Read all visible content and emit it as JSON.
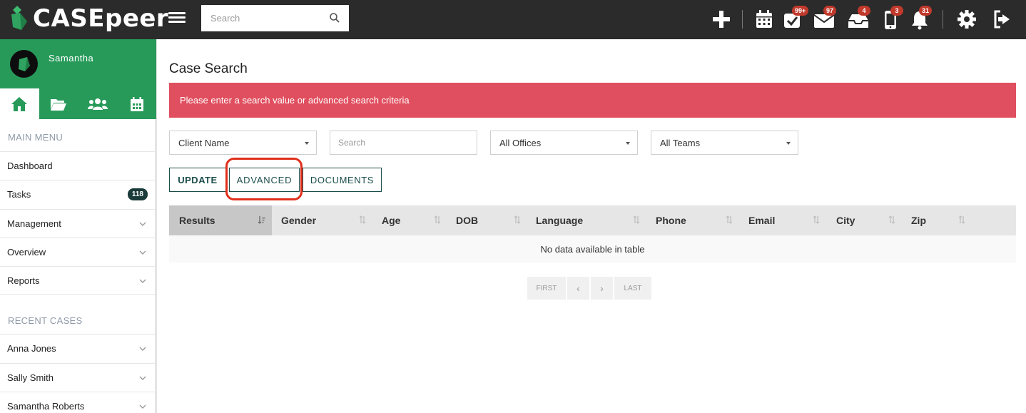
{
  "app": {
    "brand": "CASEpeer",
    "search_placeholder": "Search"
  },
  "toolbar": {
    "icons": [
      "plus-icon",
      "calendar-icon",
      "tasks-check-icon",
      "mail-icon",
      "inbox-icon",
      "mobile-icon",
      "bell-icon",
      "gear-icon",
      "logout-icon"
    ],
    "badges": {
      "tasks": "99+",
      "mail": "97",
      "inbox": "4",
      "mobile": "3",
      "bell": "31"
    },
    "badge_color": "#c0392b"
  },
  "sidebar": {
    "user_name": "Samantha",
    "accent": "#279a5a",
    "tabs": [
      "home-icon",
      "folder-icon",
      "users-icon",
      "calendar-icon"
    ],
    "main_menu_label": "MAIN MENU",
    "main_menu": [
      {
        "label": "Dashboard"
      },
      {
        "label": "Tasks",
        "count": "118"
      },
      {
        "label": "Management"
      },
      {
        "label": "Overview"
      },
      {
        "label": "Reports"
      }
    ],
    "recent_cases_label": "RECENT CASES",
    "recent_cases": [
      {
        "label": "Anna Jones"
      },
      {
        "label": "Sally Smith"
      },
      {
        "label": "Samantha Roberts"
      }
    ]
  },
  "main": {
    "title": "Case Search",
    "alert": "Please enter a search value or advanced search criteria",
    "alert_color": "#e04f5f",
    "filters": {
      "field_select": "Client Name",
      "search_placeholder": "Search",
      "office_select": "All Offices",
      "team_select": "All Teams"
    },
    "buttons": {
      "update": "UPDATE",
      "advanced": "ADVANCED",
      "documents": "DOCUMENTS"
    },
    "table": {
      "columns": [
        "Results",
        "Gender",
        "Age",
        "DOB",
        "Language",
        "Phone",
        "Email",
        "City",
        "Zip"
      ],
      "empty_message": "No data available in table"
    },
    "pagination": {
      "first": "FIRST",
      "prev": "‹",
      "next": "›",
      "last": "LAST"
    }
  }
}
